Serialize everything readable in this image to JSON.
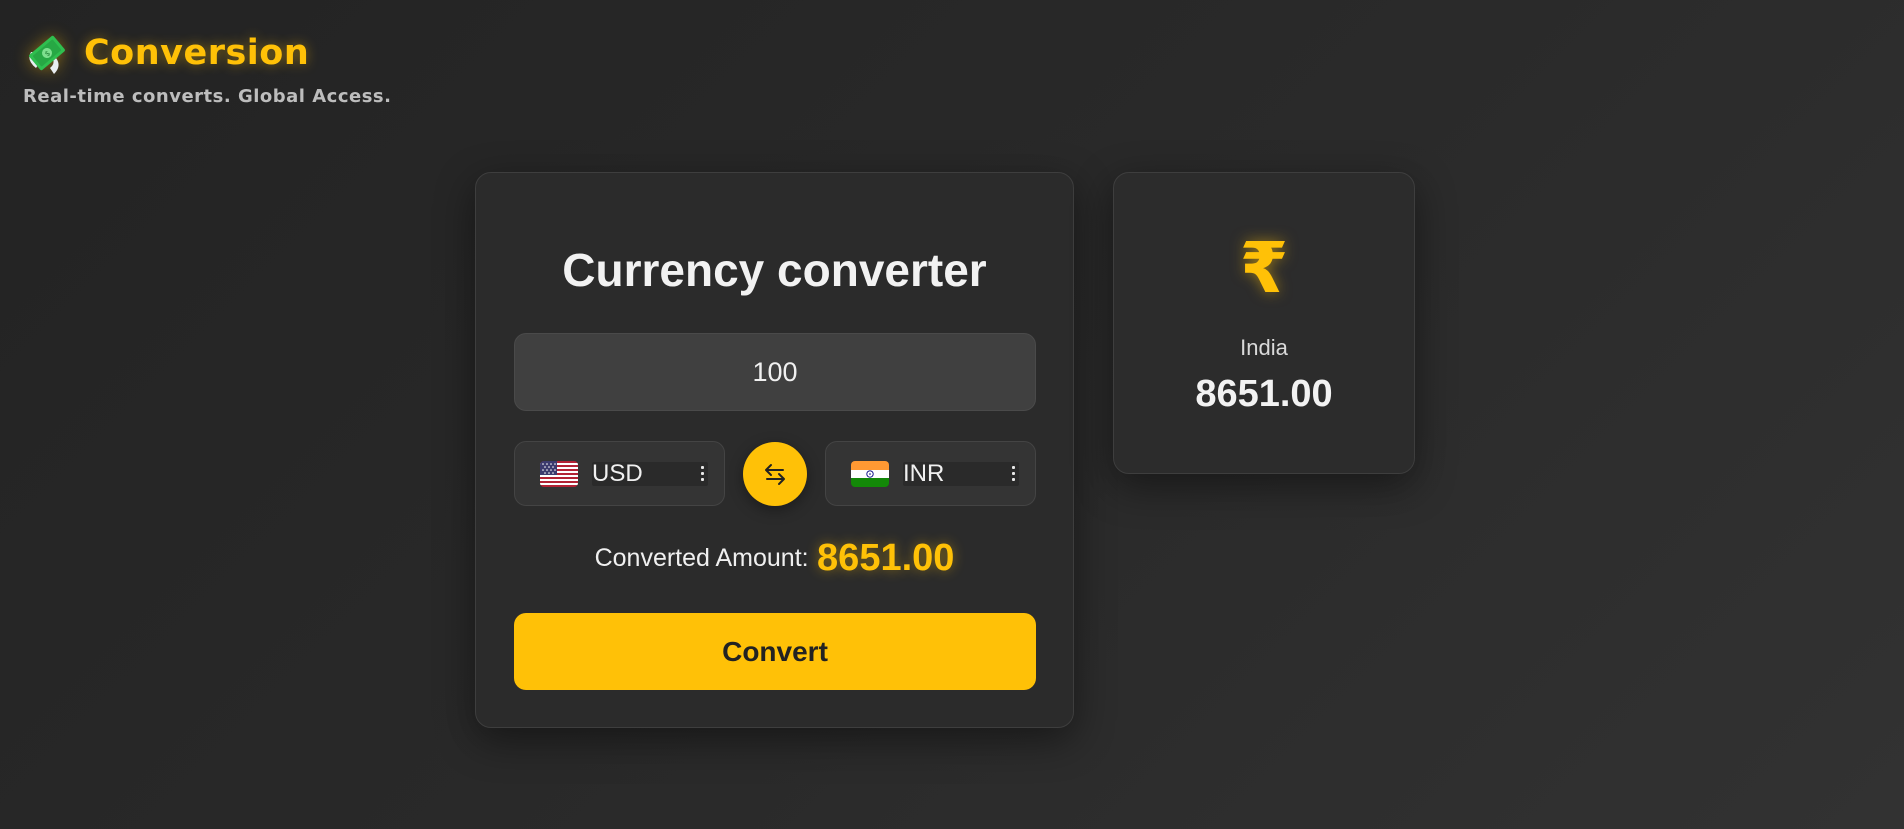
{
  "brand": {
    "title": "Conversion",
    "tagline": "Real-time converts. Global Access.",
    "logo_icon": "money-with-wings-icon"
  },
  "converter": {
    "title": "Currency converter",
    "amount_value": "100",
    "from_currency": "USD",
    "from_flag": "us-flag-icon",
    "to_currency": "INR",
    "to_flag": "india-flag-icon",
    "swap_icon": "swap-arrows-icon",
    "result_label": "Converted Amount:",
    "result_value": "8651.00",
    "convert_label": "Convert"
  },
  "country_card": {
    "symbol": "₹",
    "country": "India",
    "value": "8651.00"
  },
  "colors": {
    "accent": "#ffc107",
    "background": "#262626",
    "card": "#2b2b2b",
    "input": "#404040"
  }
}
